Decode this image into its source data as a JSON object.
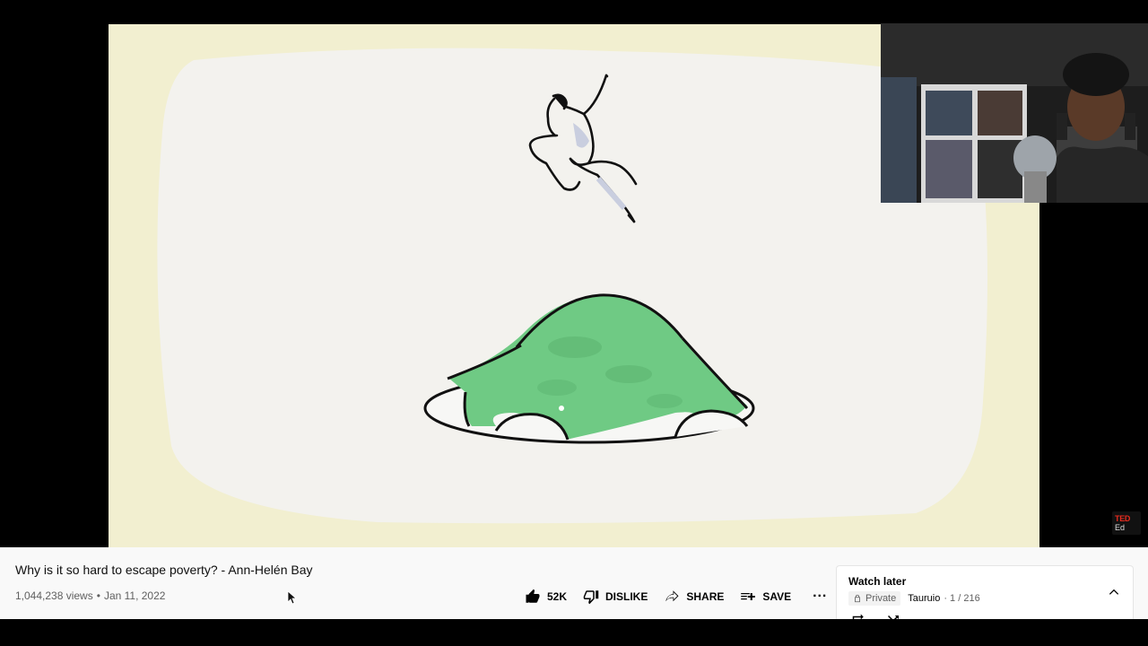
{
  "video": {
    "title": "Why is it so hard to escape poverty? - Ann-Helén Bay",
    "views": "1,044,238 views",
    "date": "Jan 11, 2022",
    "meta_separator": "•"
  },
  "watermark": {
    "line1": "TED",
    "line2": "Ed"
  },
  "actions": {
    "like_count": "52K",
    "dislike_label": "DISLIKE",
    "share_label": "SHARE",
    "save_label": "SAVE",
    "more_label": "···"
  },
  "playlist": {
    "title": "Watch later",
    "privacy": "Private",
    "owner": "Tauruio",
    "progress": "· 1 / 216"
  },
  "icons": {
    "like": "thumb-up-icon",
    "dislike": "thumb-down-icon",
    "share": "share-arrow-icon",
    "save": "playlist-add-icon",
    "privacy": "lock-icon",
    "toggle": "chevron-up-icon"
  },
  "colors": {
    "page_background": "#f9f9f9",
    "frame_cream": "#f2efd0",
    "paper_white": "#f3f2ee",
    "hill_green": "#6fca84",
    "primary_text": "#0f0f0f",
    "secondary_text": "#606060",
    "ted_red": "#e62b1e"
  }
}
